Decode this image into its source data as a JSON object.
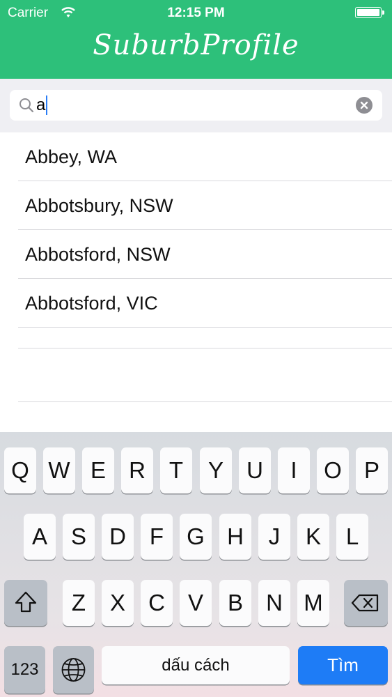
{
  "status_bar": {
    "carrier": "Carrier",
    "time": "12:15 PM"
  },
  "header": {
    "title": "SuburbProfile",
    "color": "#2dc07a"
  },
  "search": {
    "query": "a"
  },
  "results": [
    {
      "label": "Abbey, WA"
    },
    {
      "label": "Abbotsbury, NSW"
    },
    {
      "label": "Abbotsford, NSW"
    },
    {
      "label": "Abbotsford, VIC"
    }
  ],
  "keyboard": {
    "row1": [
      "Q",
      "W",
      "E",
      "R",
      "T",
      "Y",
      "U",
      "I",
      "O",
      "P"
    ],
    "row2": [
      "A",
      "S",
      "D",
      "F",
      "G",
      "H",
      "J",
      "K",
      "L"
    ],
    "row3": [
      "Z",
      "X",
      "C",
      "V",
      "B",
      "N",
      "M"
    ],
    "numbers_label": "123",
    "space_label": "dấu cách",
    "return_label": "Tìm",
    "return_color": "#1e7cf6",
    "icons": {
      "shift": "shift-icon",
      "delete": "delete-icon",
      "globe": "globe-icon"
    }
  }
}
